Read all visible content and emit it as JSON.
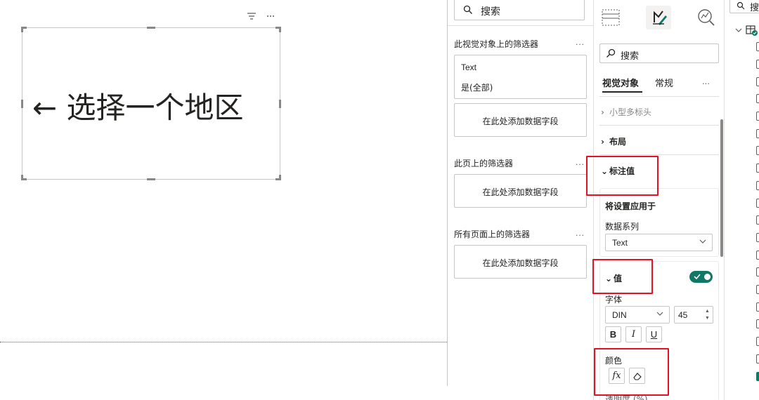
{
  "canvas": {
    "card_text": "← 选择一个地区"
  },
  "filter_pane": {
    "search_placeholder": "搜索",
    "visual_filters_title": "此视觉对象上的筛选器",
    "filter_field_name": "Text",
    "filter_field_value": "是(全部)",
    "add_field_label_1": "在此处添加数据字段",
    "page_filters_title": "此页上的筛选器",
    "add_field_label_2": "在此处添加数据字段",
    "all_pages_filters_title": "所有页面上的筛选器",
    "add_field_label_3": "在此处添加数据字段",
    "more_glyph": "..."
  },
  "format_pane": {
    "search_placeholder": "搜索",
    "tabs": [
      {
        "label": "视觉对象",
        "active": true
      },
      {
        "label": "常规",
        "active": false
      }
    ],
    "more_glyph": "...",
    "sections": {
      "small_multiples_header": "小型多标头",
      "layout": "布局",
      "callout_value": "标注值"
    },
    "apply_settings_to": "将设置应用于",
    "series_label": "数据系列",
    "series_value": "Text",
    "value_section": "值",
    "value_toggle_on": true,
    "font_label": "字体",
    "font_family": "DIN",
    "font_size": "45",
    "bold_btn": "B",
    "italic_btn": "I",
    "underline_btn": "U",
    "color_label": "颜色",
    "fx_btn": "fx",
    "transparency_label_cut": "透明度 (%)"
  },
  "data_pane": {
    "search_placeholder": "搜"
  },
  "colors": {
    "accent_green": "#117865",
    "highlight_red": "#e81123",
    "border": "#c8c6c4"
  }
}
